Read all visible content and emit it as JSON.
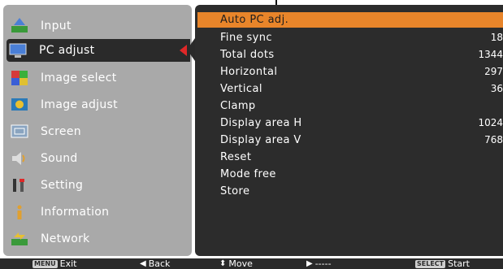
{
  "menu": {
    "items": [
      {
        "label": "Input",
        "icon": "input-icon"
      },
      {
        "label": "PC adjust",
        "icon": "pc-adjust-icon"
      },
      {
        "label": "Image select",
        "icon": "image-select-icon"
      },
      {
        "label": "Image adjust",
        "icon": "image-adjust-icon"
      },
      {
        "label": "Screen",
        "icon": "screen-icon"
      },
      {
        "label": "Sound",
        "icon": "sound-icon"
      },
      {
        "label": "Setting",
        "icon": "setting-icon"
      },
      {
        "label": "Information",
        "icon": "information-icon"
      },
      {
        "label": "Network",
        "icon": "network-icon"
      }
    ],
    "selected": "PC adjust"
  },
  "submenu": {
    "items": [
      {
        "label": "Auto PC adj.",
        "value": ""
      },
      {
        "label": "Fine sync",
        "value": "18"
      },
      {
        "label": "Total dots",
        "value": "1344"
      },
      {
        "label": "Horizontal",
        "value": "297"
      },
      {
        "label": "Vertical",
        "value": "36"
      },
      {
        "label": "Clamp",
        "value": ""
      },
      {
        "label": "Display area H",
        "value": "1024"
      },
      {
        "label": "Display area V",
        "value": "768"
      },
      {
        "label": "Reset",
        "value": ""
      },
      {
        "label": "Mode free",
        "value": ""
      },
      {
        "label": "Store",
        "value": ""
      }
    ],
    "active": "Auto PC adj."
  },
  "footer": {
    "exit_key": "MENU",
    "exit_label": "Exit",
    "back_label": "Back",
    "move_label": "Move",
    "next_label": "-----",
    "select_key": "SELECT",
    "start_label": "Start"
  },
  "colors": {
    "highlight": "#e8852a",
    "panel_dark": "#2c2c2c",
    "panel_light": "#a9a9a9",
    "selector_arrow": "#e02828"
  }
}
